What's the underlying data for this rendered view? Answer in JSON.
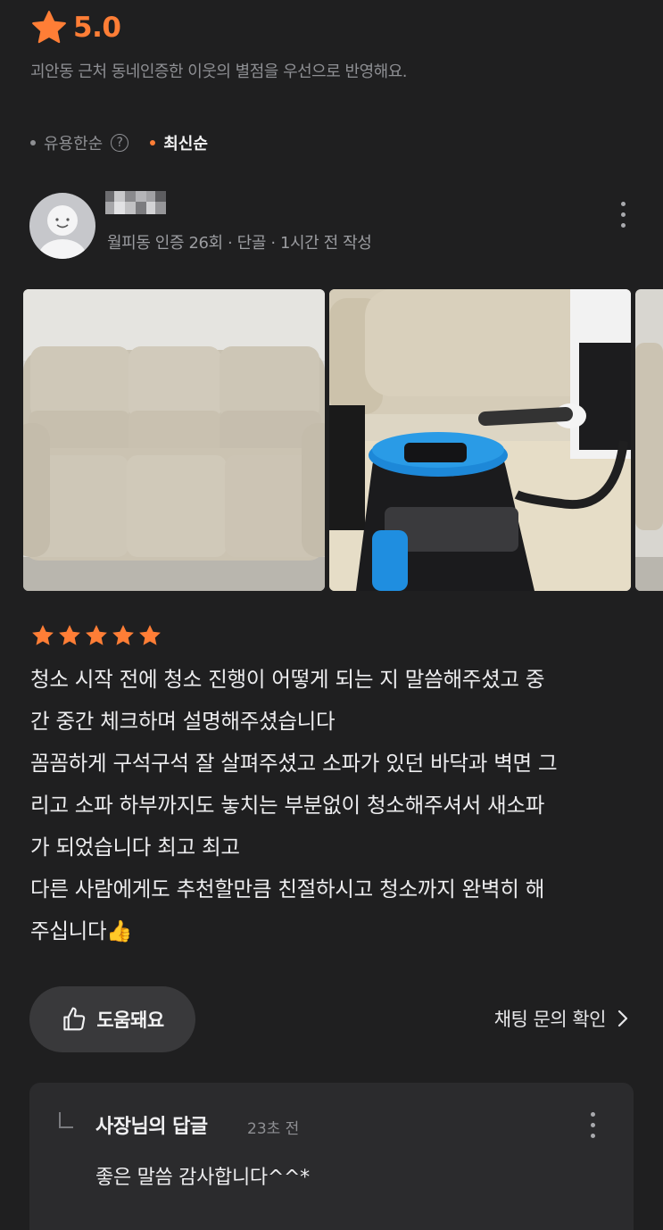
{
  "rating": {
    "value": "5.0",
    "note": "괴안동 근처 동네인증한 이웃의 별점을 우선으로 반영해요.",
    "star_color": "#ff7e36"
  },
  "sort": {
    "helpful_label": "유용한순",
    "help_icon_glyph": "?",
    "latest_label": "최신순",
    "active": "최신순",
    "active_dot_color": "#ff7e36",
    "inactive_dot_color": "#8e8f93"
  },
  "review": {
    "reviewer_meta": "월피동 인증 26회 · 단골 · 1시간 전 작성",
    "stars": 5,
    "text": "청소 시작 전에 청소 진행이 어떻게 되는 지 말씀해주셨고 중\n간 중간 체크하며 설명해주셨습니다\n꼼꼼하게 구석구석 잘 살펴주셨고 소파가 있던 바닥과 벽면 그\n리고 소파 하부까지도 놓치는 부분없이 청소해주셔서 새소파\n가 되었습니다 최고 최고\n다른 사람에게도 추천할만큼 친절하시고 청소까지 완벽히 해\n주십니다👍",
    "photos": [
      "sofa-photo",
      "cleaning-photo",
      "sofa-photo-partial"
    ]
  },
  "actions": {
    "helpful_label": "도움돼요",
    "chat_link_label": "채팅 문의 확인"
  },
  "reply": {
    "author": "사장님의 답글",
    "time": "23초 전",
    "text": "좋은 말씀 감사합니다^^*"
  },
  "icons": {
    "rating": "star-icon",
    "help": "question-circle-icon",
    "more": "more-vertical-icon",
    "helpful": "thumbs-up-icon",
    "chat": "chevron-right-icon",
    "reply": "reply-corner-icon"
  }
}
